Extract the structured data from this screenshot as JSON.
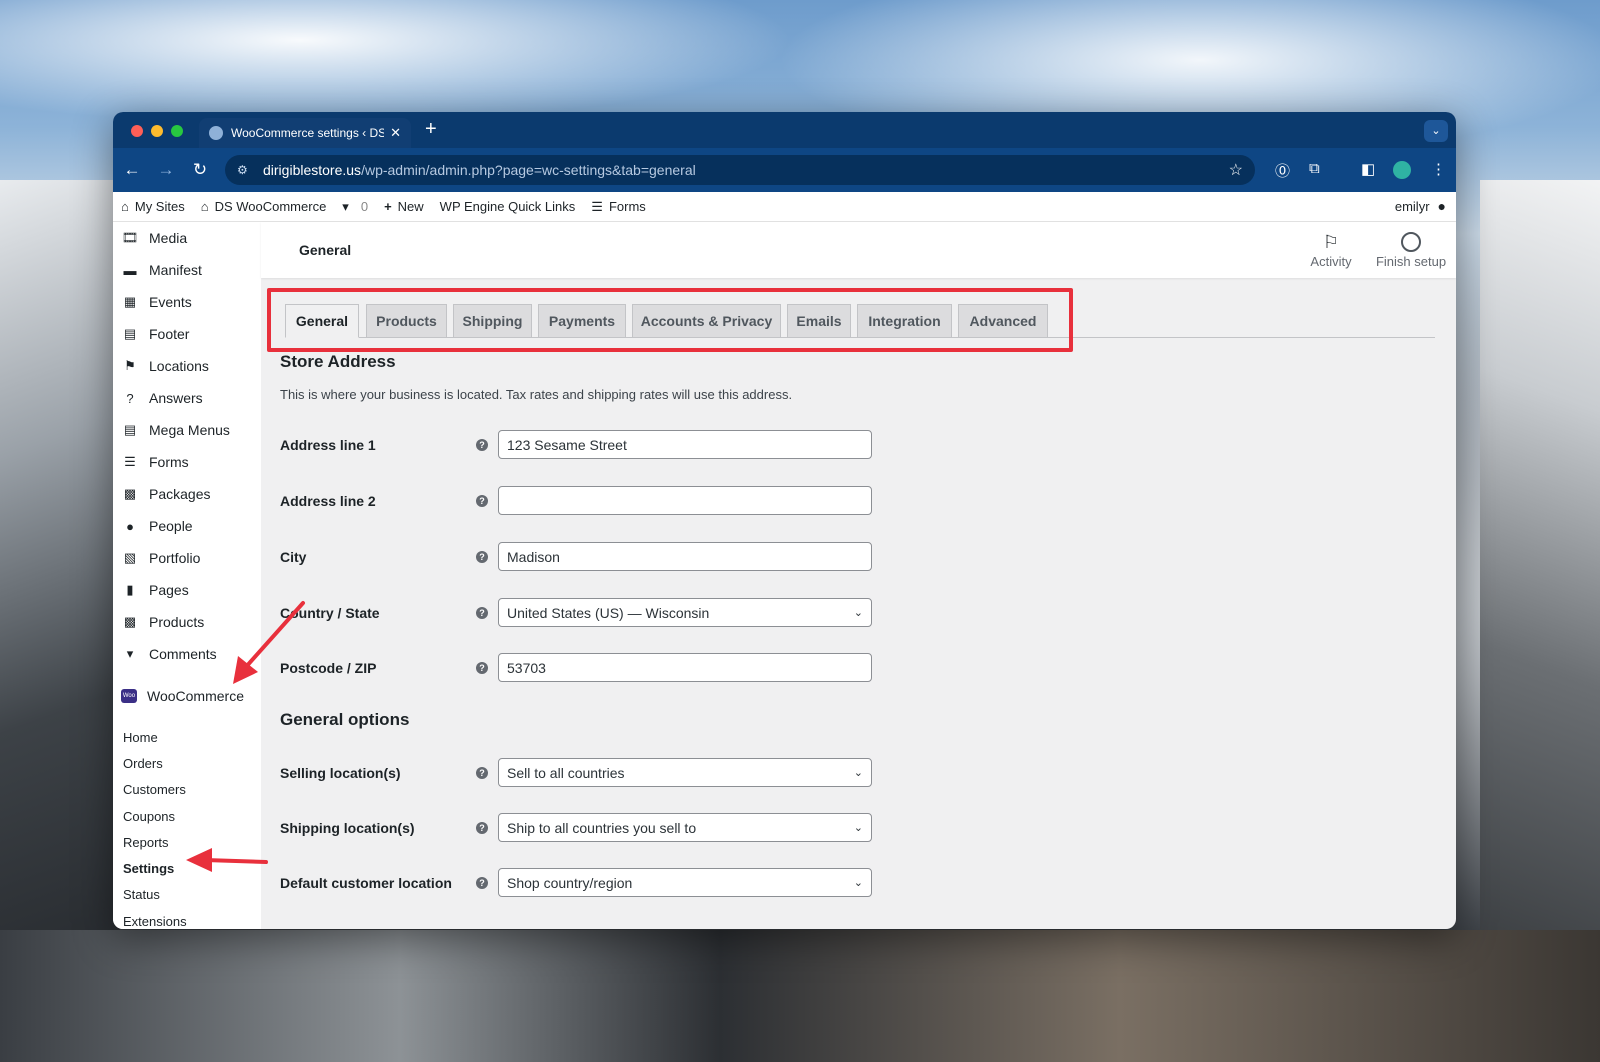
{
  "browser": {
    "tab_title": "WooCommerce settings ‹ DS",
    "tab_close": "✕",
    "new_tab": "+",
    "url_host": "dirigiblestore.us",
    "url_path": "/wp-admin/admin.php?page=wc-settings&tab=general"
  },
  "adminbar": {
    "my_sites": "My Sites",
    "site_name": "DS WooCommerce",
    "comments_count": "0",
    "new": "New",
    "quick_links": "WP Engine Quick Links",
    "forms": "Forms",
    "user": "emilyr"
  },
  "sidebar": {
    "items": [
      {
        "label": "Media",
        "icon": "media-icon",
        "glyph": "🎞"
      },
      {
        "label": "Manifest",
        "icon": "folder-icon",
        "glyph": "▬"
      },
      {
        "label": "Events",
        "icon": "calendar-icon",
        "glyph": "▦"
      },
      {
        "label": "Footer",
        "icon": "grid-icon",
        "glyph": "▤"
      },
      {
        "label": "Locations",
        "icon": "map-icon",
        "glyph": "⚑"
      },
      {
        "label": "Answers",
        "icon": "question-icon",
        "glyph": "?"
      },
      {
        "label": "Mega Menus",
        "icon": "grid-icon",
        "glyph": "▤"
      },
      {
        "label": "Forms",
        "icon": "forms-icon",
        "glyph": "☰"
      },
      {
        "label": "Packages",
        "icon": "store-icon",
        "glyph": "▩"
      },
      {
        "label": "People",
        "icon": "person-icon",
        "glyph": "●"
      },
      {
        "label": "Portfolio",
        "icon": "portfolio-icon",
        "glyph": "▧"
      },
      {
        "label": "Pages",
        "icon": "pages-icon",
        "glyph": "▮"
      },
      {
        "label": "Products",
        "icon": "store-icon",
        "glyph": "▩"
      },
      {
        "label": "Comments",
        "icon": "comment-icon",
        "glyph": "▾"
      }
    ],
    "woocommerce": "WooCommerce",
    "woo_logo": "Woo",
    "submenu": [
      "Home",
      "Orders",
      "Customers",
      "Coupons",
      "Reports",
      "Settings",
      "Status",
      "Extensions"
    ]
  },
  "header": {
    "title": "General",
    "activity": "Activity",
    "finish_setup": "Finish setup"
  },
  "tabs": [
    "General",
    "Products",
    "Shipping",
    "Payments",
    "Accounts & Privacy",
    "Emails",
    "Integration",
    "Advanced"
  ],
  "store_address": {
    "heading": "Store Address",
    "description": "This is where your business is located. Tax rates and shipping rates will use this address.",
    "address1_label": "Address line 1",
    "address1_value": "123 Sesame Street",
    "address2_label": "Address line 2",
    "address2_value": "",
    "city_label": "City",
    "city_value": "Madison",
    "country_label": "Country / State",
    "country_value": "United States (US) — Wisconsin",
    "postcode_label": "Postcode / ZIP",
    "postcode_value": "53703"
  },
  "general_options": {
    "heading": "General options",
    "selling_label": "Selling location(s)",
    "selling_value": "Sell to all countries",
    "shipping_label": "Shipping location(s)",
    "shipping_value": "Ship to all countries you sell to",
    "default_loc_label": "Default customer location",
    "default_loc_value": "Shop country/region"
  },
  "colors": {
    "annotation_red": "#e8303c",
    "browser_chrome": "#0e4684"
  }
}
